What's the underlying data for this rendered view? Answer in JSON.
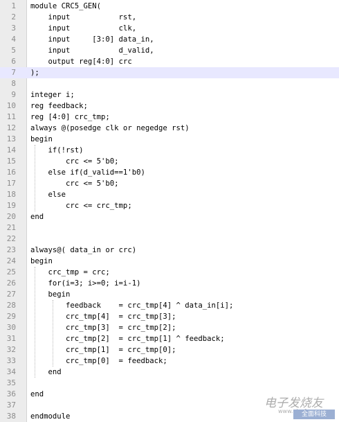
{
  "editor": {
    "current_line": 7,
    "colors": {
      "gutter": "#ececec",
      "line_numbers": "#8c8c8c",
      "current_line_highlight": "#e8e8ff",
      "text": "#000000"
    },
    "lines": [
      {
        "n": "1",
        "text": "module CRC5_GEN("
      },
      {
        "n": "2",
        "text": "    input           rst,"
      },
      {
        "n": "3",
        "text": "    input           clk,"
      },
      {
        "n": "4",
        "text": "    input     [3:0] data_in,"
      },
      {
        "n": "5",
        "text": "    input           d_valid,"
      },
      {
        "n": "6",
        "text": "    output reg[4:0] crc"
      },
      {
        "n": "7",
        "text": ");"
      },
      {
        "n": "8",
        "text": ""
      },
      {
        "n": "9",
        "text": "integer i;"
      },
      {
        "n": "10",
        "text": "reg feedback;"
      },
      {
        "n": "11",
        "text": "reg [4:0] crc_tmp;"
      },
      {
        "n": "12",
        "text": "always @(posedge clk or negedge rst)"
      },
      {
        "n": "13",
        "text": "begin"
      },
      {
        "n": "14",
        "text": "    if(!rst)"
      },
      {
        "n": "15",
        "text": "        crc <= 5'b0;"
      },
      {
        "n": "16",
        "text": "    else if(d_valid==1'b0)"
      },
      {
        "n": "17",
        "text": "        crc <= 5'b0;"
      },
      {
        "n": "18",
        "text": "    else"
      },
      {
        "n": "19",
        "text": "        crc <= crc_tmp;"
      },
      {
        "n": "20",
        "text": "end"
      },
      {
        "n": "21",
        "text": ""
      },
      {
        "n": "22",
        "text": ""
      },
      {
        "n": "23",
        "text": "always@( data_in or crc)"
      },
      {
        "n": "24",
        "text": "begin"
      },
      {
        "n": "25",
        "text": "    crc_tmp = crc;"
      },
      {
        "n": "26",
        "text": "    for(i=3; i>=0; i=i-1)"
      },
      {
        "n": "27",
        "text": "    begin"
      },
      {
        "n": "28",
        "text": "        feedback    = crc_tmp[4] ^ data_in[i];"
      },
      {
        "n": "29",
        "text": "        crc_tmp[4]  = crc_tmp[3];"
      },
      {
        "n": "30",
        "text": "        crc_tmp[3]  = crc_tmp[2];"
      },
      {
        "n": "31",
        "text": "        crc_tmp[2]  = crc_tmp[1] ^ feedback;"
      },
      {
        "n": "32",
        "text": "        crc_tmp[1]  = crc_tmp[0];"
      },
      {
        "n": "33",
        "text": "        crc_tmp[0]  = feedback;"
      },
      {
        "n": "34",
        "text": "    end"
      },
      {
        "n": "35",
        "text": ""
      },
      {
        "n": "36",
        "text": "end"
      },
      {
        "n": "37",
        "text": ""
      },
      {
        "n": "38",
        "text": "endmodule"
      }
    ]
  },
  "watermark": {
    "text": "电子发烧友",
    "url": "www.elecfans.com",
    "logo": "全面科技"
  }
}
